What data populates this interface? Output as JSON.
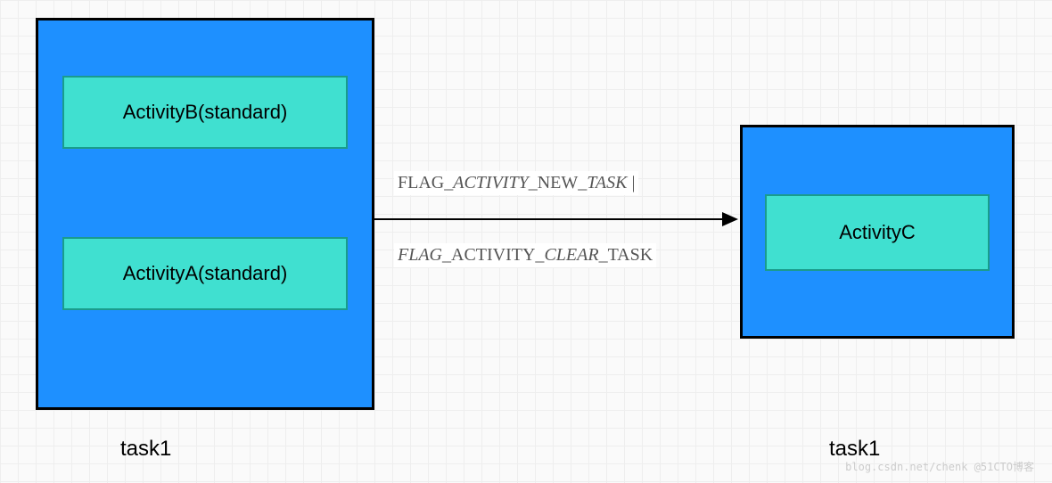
{
  "leftTask": {
    "label": "task1",
    "activities": [
      {
        "name": "ActivityB(standard)"
      },
      {
        "name": "ActivityA(standard)"
      }
    ]
  },
  "rightTask": {
    "label": "task1",
    "activities": [
      {
        "name": "ActivityC"
      }
    ]
  },
  "arrow": {
    "topLabel": {
      "prefix": "FLAG_",
      "italic1": "ACTIVITY",
      "mid": "_NEW_",
      "italic2": "TASK",
      "suffix": " |"
    },
    "bottomLabel": {
      "italic1": "FLAG",
      "mid1": "_ACTIVITY_",
      "italic2": "CLEAR",
      "suffix": "_TASK"
    }
  },
  "watermark": {
    "text1": "",
    "text2": "blog.csdn.net/chenk @51CTO博客"
  }
}
